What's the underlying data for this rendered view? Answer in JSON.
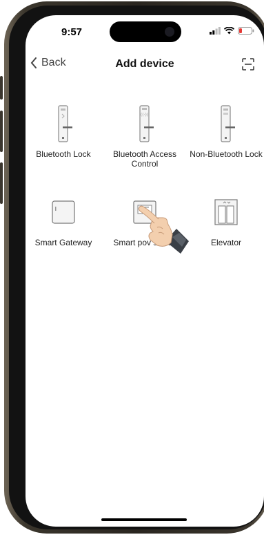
{
  "status": {
    "time": "9:57"
  },
  "nav": {
    "back_label": "Back",
    "title": "Add device"
  },
  "devices": [
    {
      "label": "Bluetooth Lock",
      "icon": "bluetooth-lock-icon"
    },
    {
      "label": "Bluetooth Access Control",
      "icon": "access-control-icon"
    },
    {
      "label": "Non-Bluetooth Lock",
      "icon": "non-bluetooth-lock-icon"
    },
    {
      "label": "Smart Gateway",
      "icon": "gateway-icon"
    },
    {
      "label": "Smart pov switch",
      "icon": "power-switch-icon"
    },
    {
      "label": "Elevator",
      "icon": "elevator-icon"
    }
  ],
  "colors": {
    "battery_low": "#e53935",
    "accent": "#111111"
  }
}
